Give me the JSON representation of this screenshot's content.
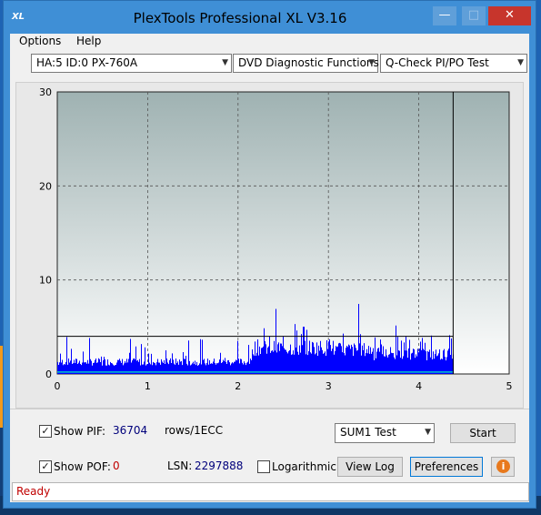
{
  "window": {
    "title": "PlexTools Professional XL V3.16",
    "icon_text": "XL"
  },
  "menu": [
    {
      "label": "Options"
    },
    {
      "label": "Help"
    }
  ],
  "toolbar": {
    "drive": "HA:5 ID:0  PX-760A",
    "function": "DVD Diagnostic Functions",
    "test": "Q-Check PI/PO Test"
  },
  "chart_data": {
    "type": "bar",
    "xlim": [
      0,
      5
    ],
    "ylim": [
      0,
      30
    ],
    "x_ticks": [
      "0",
      "1",
      "2",
      "3",
      "4",
      "5"
    ],
    "y_ticks": [
      "0",
      "10",
      "20",
      "30"
    ],
    "end_marker_x": 4.38,
    "threshold_y": 4,
    "grid": true,
    "series": [
      {
        "color": "#0000ff",
        "segments": [
          {
            "x": [
              0.0,
              2.15
            ],
            "typical": 1.6,
            "peak": 4
          },
          {
            "x": [
              2.15,
              3.0
            ],
            "typical": 3.5,
            "peak": 8
          },
          {
            "x": [
              3.0,
              3.5
            ],
            "typical": 3.2,
            "peak": 9
          },
          {
            "x": [
              3.5,
              4.38
            ],
            "typical": 2.6,
            "peak": 5.5
          }
        ]
      },
      {
        "color": "#00c8c8",
        "level": 0.2,
        "x": [
          0.0,
          4.38
        ]
      }
    ]
  },
  "controls": {
    "show_pif_label": "Show PIF:",
    "pif_value": "36704",
    "rows_label": "rows/1ECC",
    "show_pof_label": "Show POF:",
    "pof_value": "0",
    "lsn_label": "LSN:",
    "lsn_value": "2297888",
    "log_label": "Logarithmic",
    "sum_select": "SUM1 Test",
    "start": "Start",
    "view_log": "View Log",
    "preferences": "Preferences",
    "pif_checked": "✓",
    "pof_checked": "✓"
  },
  "status": "Ready",
  "colors": {
    "accent": "#3f8fd6",
    "plot_top": "#9fb2b2",
    "plot_bottom": "#ffffff",
    "status_text": "#c00000"
  }
}
